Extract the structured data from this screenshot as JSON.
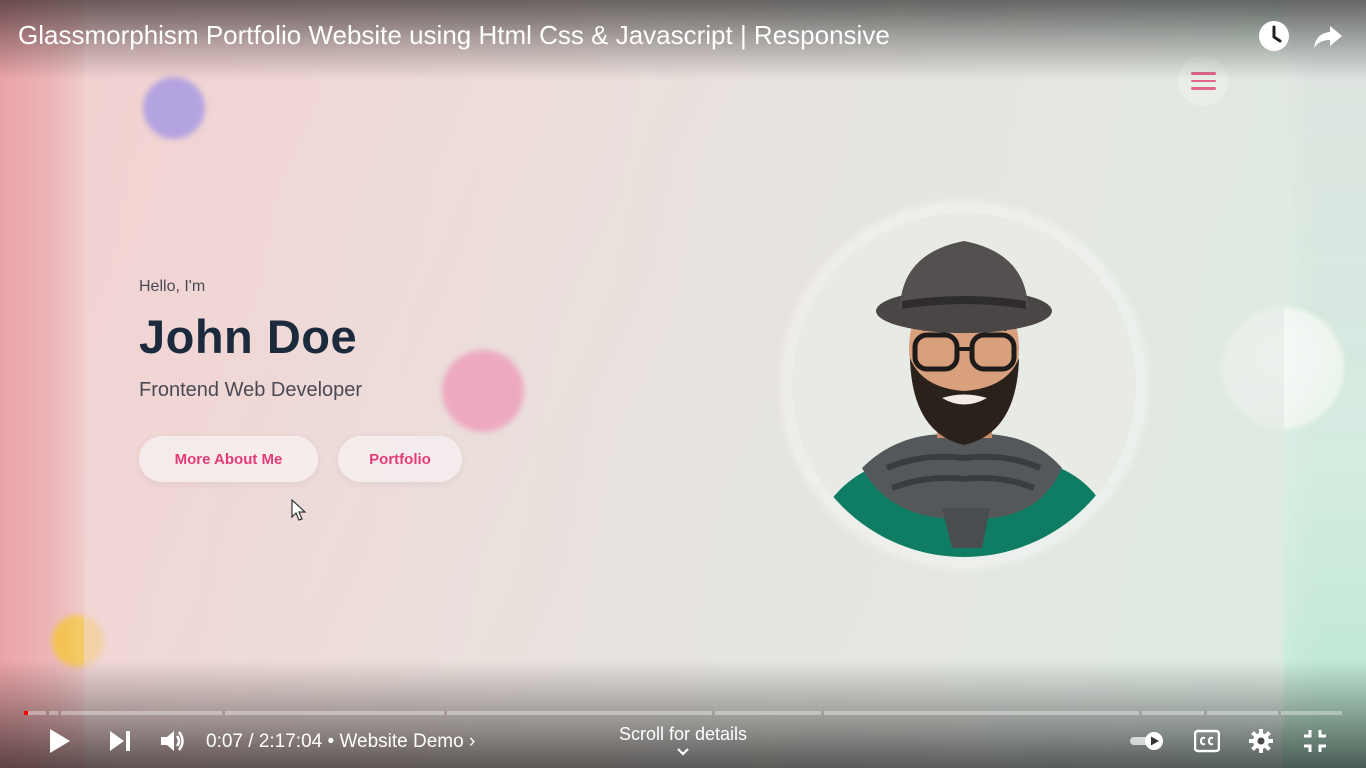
{
  "video": {
    "title": "Glassmorphism Portfolio Website using Html Css & Javascript | Responsive",
    "watch_later_icon": "clock-icon",
    "share_icon": "share-arrow-icon"
  },
  "site": {
    "greeting": "Hello, I'm",
    "name": "John Doe",
    "role": "Frontend Web Developer",
    "buttons": {
      "about": "More About Me",
      "portfolio": "Portfolio"
    },
    "menu_icon": "hamburger-menu-icon",
    "accent_color": "#e23d78",
    "heading_color": "#1b2a3c"
  },
  "controls": {
    "current_time": "0:07",
    "duration": "2:17:04",
    "chapter": "Website Demo",
    "chapter_separator": "•",
    "time_separator": "/",
    "chapter_chevron": "›",
    "scroll_hint": "Scroll for details",
    "progress_fraction": 0.0009,
    "icons": [
      "play-icon",
      "next-icon",
      "volume-icon",
      "autoplay-toggle-icon",
      "captions-icon",
      "settings-icon",
      "exit-fullscreen-icon",
      "chevron-down-icon"
    ]
  }
}
